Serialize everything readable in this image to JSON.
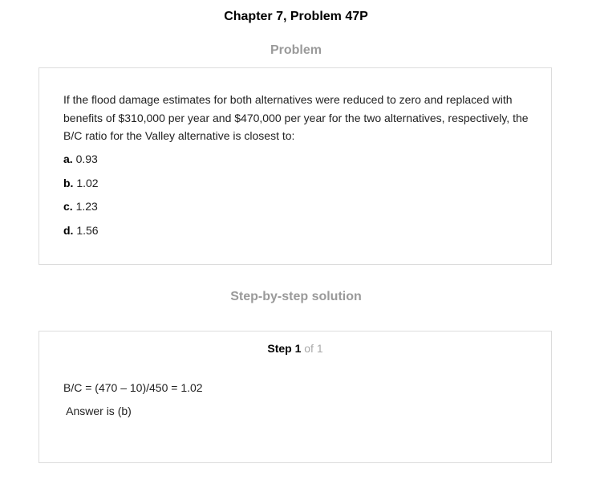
{
  "page_title": "Chapter 7, Problem 47P",
  "problem": {
    "heading": "Problem",
    "text": "If the flood damage estimates for both alternatives were reduced to zero and replaced with benefits of $310,000 per year and $470,000 per year for the two alternatives, respectively, the B/C ratio for the Valley alternative is closest to:",
    "options": [
      {
        "letter": "a.",
        "value": "0.93"
      },
      {
        "letter": "b.",
        "value": "1.02"
      },
      {
        "letter": "c.",
        "value": "1.23"
      },
      {
        "letter": "d.",
        "value": "1.56"
      }
    ]
  },
  "solution": {
    "heading": "Step-by-step solution",
    "step_label": "Step 1",
    "step_of": "of 1",
    "lines": [
      "B/C = (470 – 10)/450 = 1.02",
      " Answer is (b)"
    ]
  },
  "colors": {
    "section_heading": "#9a9a9a",
    "card_border": "#dcdcdc",
    "step_of": "#a8a8a8"
  }
}
